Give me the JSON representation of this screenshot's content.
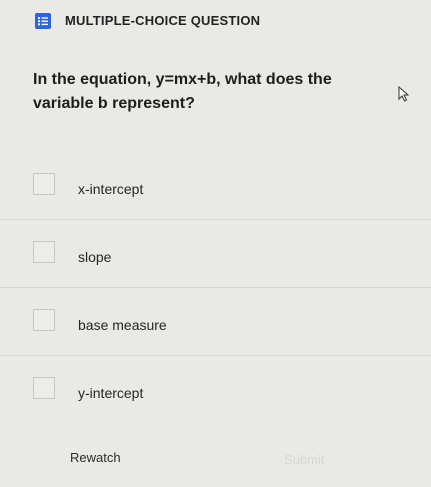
{
  "header": {
    "icon": "list-icon",
    "accent_color": "#2a66d8",
    "question_type": "MULTIPLE-CHOICE QUESTION"
  },
  "question": {
    "prompt": "In the equation, y=mx+b, what does the variable b represent?"
  },
  "choices": [
    {
      "label": "x-intercept",
      "checked": false
    },
    {
      "label": "slope",
      "checked": false
    },
    {
      "label": "base measure",
      "checked": false
    },
    {
      "label": "y-intercept",
      "checked": false
    }
  ],
  "footer": {
    "rewatch_label": "Rewatch",
    "submit_label": "Submit"
  }
}
